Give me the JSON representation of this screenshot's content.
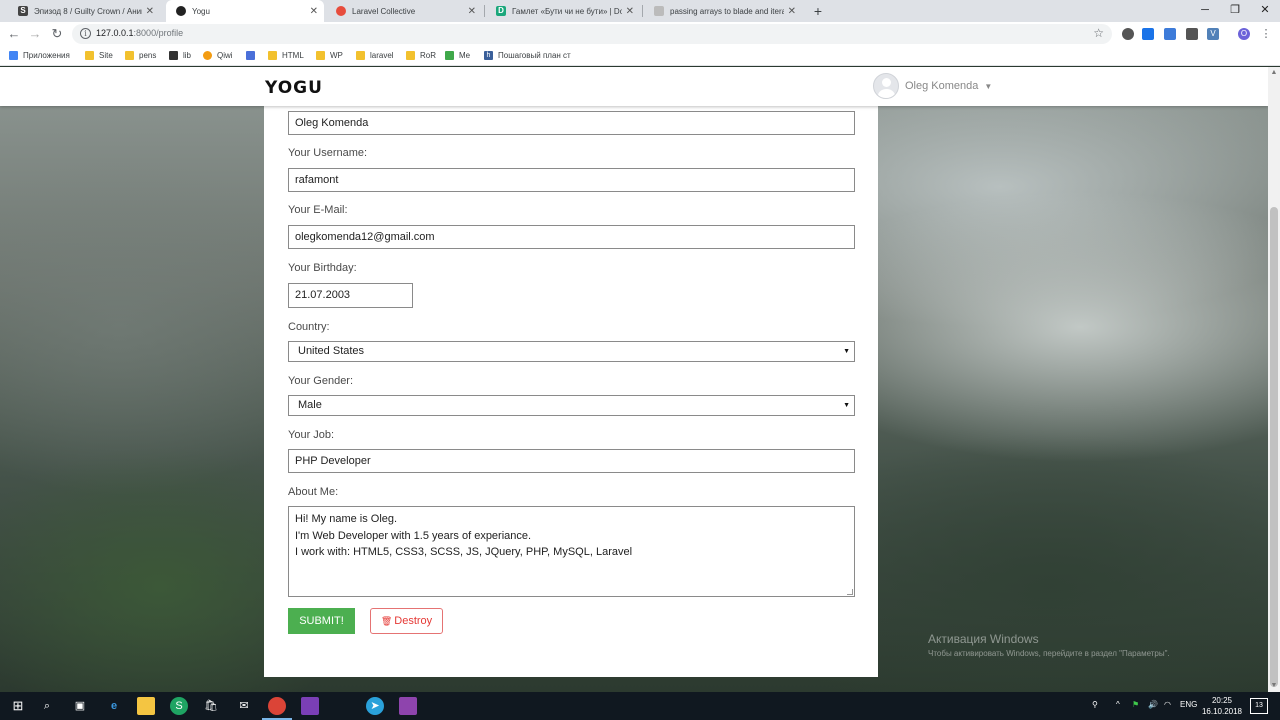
{
  "browser": {
    "tabs": [
      {
        "title": "Эпизод 8 / Guilty Crown / Аним",
        "active": false
      },
      {
        "title": "Yogu",
        "active": true
      },
      {
        "title": "Laravel Collective",
        "active": false
      },
      {
        "title": "Гамлет «Бути чи не бути» | Dov",
        "active": false
      },
      {
        "title": "passing arrays to blade and itera",
        "active": false
      }
    ],
    "url_host": "127.0.0.1",
    "url_path": ":8000/profile",
    "bookmarks": [
      "Приложения",
      "Site",
      "pens",
      "lib",
      "Qiwi",
      "HTML",
      "WP",
      "laravel",
      "RoR",
      "Me",
      "Пошаговый план ст"
    ]
  },
  "header": {
    "logo": "YOGU",
    "user_name": "Oleg Komenda"
  },
  "form": {
    "name_value": "Oleg Komenda",
    "username_label": "Your Username:",
    "username_value": "rafamont",
    "email_label": "Your E-Mail:",
    "email_value": "olegkomenda12@gmail.com",
    "birthday_label": "Your Birthday:",
    "birthday_value": "21.07.2003",
    "country_label": "Country:",
    "country_value": "United States",
    "gender_label": "Your Gender:",
    "gender_value": "Male",
    "job_label": "Your Job:",
    "job_value": "PHP Developer",
    "about_label": "About Me:",
    "about_lines": [
      "Hi! My name is Oleg.",
      "I'm Web Developer with 1.5 years of experiance.",
      "I work with: HTML5, CSS3, SCSS, JS, JQuery, PHP, MySQL, Laravel"
    ],
    "submit_label": "SUBMIT!",
    "destroy_label": "Destroy"
  },
  "watermark": {
    "line1": "Активация Windows",
    "line2": "Чтобы активировать Windows, перейдите в раздел \"Параметры\"."
  },
  "taskbar": {
    "lang": "ENG",
    "time": "20:25",
    "date": "16.10.2018",
    "notifications": "13"
  },
  "icons": {
    "brand_accent": "#4caf50",
    "destroy_color": "#e53935"
  }
}
